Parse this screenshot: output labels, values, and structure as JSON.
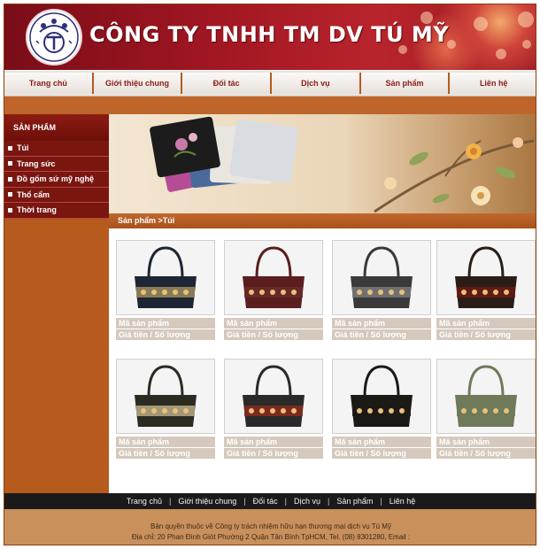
{
  "header": {
    "title": "CÔNG TY TNHH TM DV TÚ MỸ",
    "logo_icon": "company-logo-icon"
  },
  "nav": {
    "items": [
      "Trang chủ",
      "Giới thiệu chung",
      "Đối tác",
      "Dịch vụ",
      "Sản phẩm",
      "Liên hệ"
    ]
  },
  "sidebar": {
    "heading": "SẢN PHẨM",
    "items": [
      "Túi",
      "Trang sức",
      "Đồ gốm sứ mỹ nghệ",
      "Thổ cẩm",
      "Thời trang"
    ]
  },
  "breadcrumb": "Sản phẩm >Túi",
  "products": [
    {
      "code_label": "Mã sản phẩm",
      "price_label": "Giá tiền / Số lượng",
      "bag_color": "#1e2535",
      "trim_color": "#9b8a5a"
    },
    {
      "code_label": "Mã sản phẩm",
      "price_label": "Giá tiền / Số lượng",
      "bag_color": "#5a1e1e",
      "trim_color": "#6a2a2a"
    },
    {
      "code_label": "Mã sản phẩm",
      "price_label": "Giá tiền / Số lượng",
      "bag_color": "#3a3a3a",
      "trim_color": "#7a7a7a"
    },
    {
      "code_label": "Mã sản phẩm",
      "price_label": "Giá tiền / Số lượng",
      "bag_color": "#2a1d18",
      "trim_color": "#6b1a14"
    },
    {
      "code_label": "Mã sản phẩm",
      "price_label": "Giá tiền / Số lượng",
      "bag_color": "#2b2b22",
      "trim_color": "#b7ab86"
    },
    {
      "code_label": "Mã sản phẩm",
      "price_label": "Giá tiền / Số lượng",
      "bag_color": "#2a2a2a",
      "trim_color": "#8c2a1c"
    },
    {
      "code_label": "Mã sản phẩm",
      "price_label": "Giá tiền / Số lượng",
      "bag_color": "#1c1a16",
      "trim_color": "#1c1a16"
    },
    {
      "code_label": "Mã sản phẩm",
      "price_label": "Giá tiền / Số lượng",
      "bag_color": "#6e7a5a",
      "trim_color": "#6e7a5a"
    }
  ],
  "footer": {
    "links": [
      "Trang chủ",
      "Giới thiệu chung",
      "Đối tác",
      "Dịch vụ",
      "Sản phẩm",
      "Liên hệ"
    ],
    "separator": "|",
    "copyright": "Bản quyền thuộc về Công ty trách nhiệm hữu hạn thương mại dịch vụ Tú Mỹ",
    "address": "Địa chỉ: 20 Phan Đình Giót Phường 2 Quận Tân Bình TpHCM, Tel. (08) 8301280, Email :"
  },
  "colors": {
    "header_red": "#a11722",
    "sidebar_brown": "#b65a1e",
    "menu_dark_red": "#7a1610",
    "label_beige": "#d5c9bd"
  }
}
